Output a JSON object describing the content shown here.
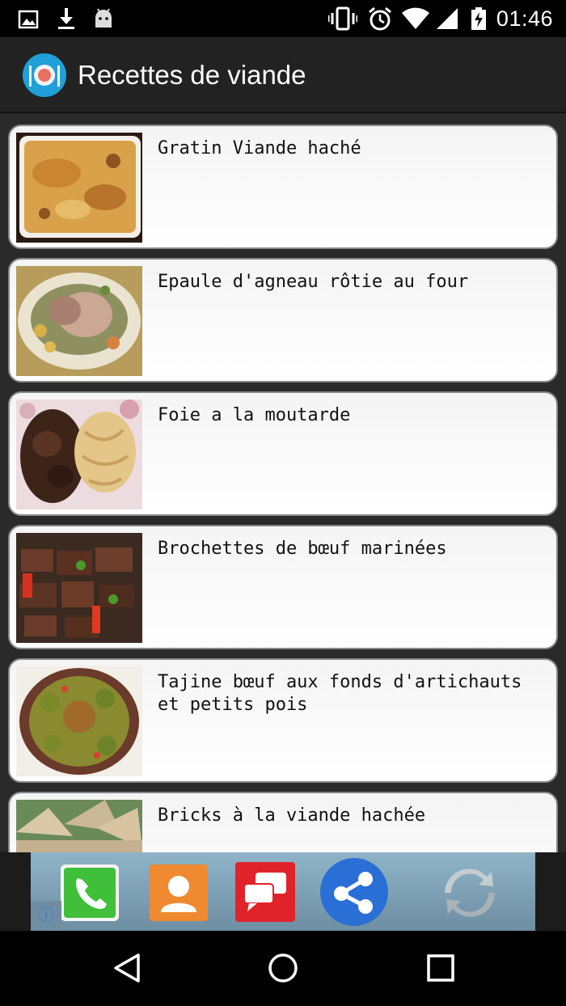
{
  "status_bar": {
    "time": "01:46",
    "left_icons": [
      "image-icon",
      "download-icon",
      "android-icon"
    ],
    "right_icons": [
      "vibrate-icon",
      "alarm-icon",
      "wifi-icon",
      "signal-icon",
      "battery-icon"
    ]
  },
  "app": {
    "title": "Recettes de viande",
    "logo_icon": "plate-fork-knife-icon",
    "logo_color": "#1fa0d9"
  },
  "recipes": [
    {
      "title": "Gratin Viande haché"
    },
    {
      "title": "Epaule d'agneau rôtie au four"
    },
    {
      "title": "Foie a la moutarde"
    },
    {
      "title": "Brochettes de bœuf marinées"
    },
    {
      "title": "Tajine bœuf aux fonds d'artichauts et petits pois"
    },
    {
      "title": "Bricks à la viande hachée"
    }
  ],
  "ad_banner": {
    "icons": [
      "phone-icon",
      "contact-icon",
      "message-icon",
      "share-icon",
      "refresh-icon"
    ],
    "info_icon": "ⓘ"
  },
  "nav_bar": {
    "icons": [
      "back-icon",
      "home-icon",
      "recents-icon"
    ]
  }
}
